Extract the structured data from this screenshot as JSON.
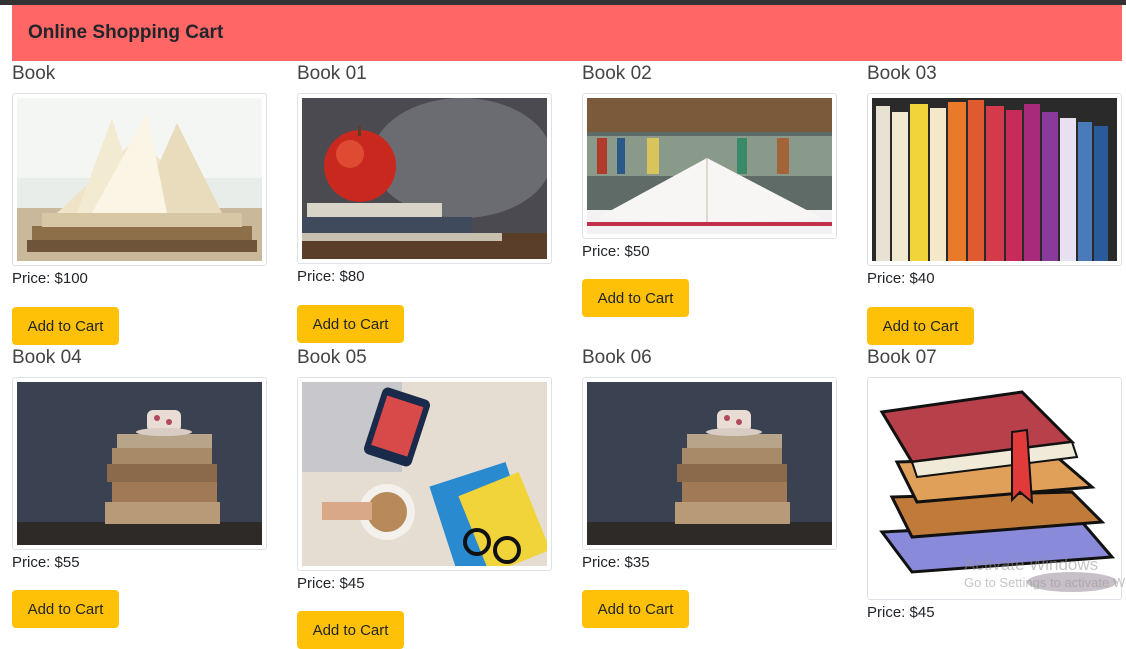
{
  "header": {
    "title": "Online Shopping Cart"
  },
  "products": [
    {
      "title": "Book",
      "price": "Price: $100",
      "button": "Add to Cart",
      "image": "open-book-pages-on-stack-photo"
    },
    {
      "title": "Book 01",
      "price": "Price: $80",
      "button": "Add to Cart",
      "image": "apple-on-books-photo"
    },
    {
      "title": "Book 02",
      "price": "Price: $50",
      "button": "Add to Cart",
      "image": "open-book-bookshelf-photo"
    },
    {
      "title": "Book 03",
      "price": "Price: $40",
      "button": "Add to Cart",
      "image": "colorful-bookshelf-photo"
    },
    {
      "title": "Book 04",
      "price": "Price: $55",
      "button": "Add to Cart",
      "image": "teacup-on-old-books-photo"
    },
    {
      "title": "Book 05",
      "price": "Price: $45",
      "button": "Add to Cart",
      "image": "phone-coffee-book-photo"
    },
    {
      "title": "Book 06",
      "price": "Price: $35",
      "button": "Add to Cart",
      "image": "teacup-on-old-books-photo"
    },
    {
      "title": "Book 07",
      "price": "Price: $45",
      "button": "Add to Cart",
      "image": "stack-of-books-clipart"
    }
  ],
  "watermark": {
    "line1": "Activate Windows",
    "line2": "Go to Settings to activate Windows."
  },
  "colors": {
    "header_bg": "#ff6666",
    "button_bg": "#ffc107",
    "thumb_border": "#dee2e6"
  }
}
